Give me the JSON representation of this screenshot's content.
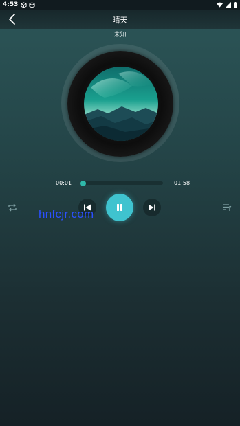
{
  "status_bar": {
    "time": "4:53",
    "left_icons": [
      "cube-icon",
      "cube-outline-icon"
    ],
    "right_icons": [
      "wifi-icon",
      "signal-icon",
      "battery-icon"
    ]
  },
  "header": {
    "title": "晴天",
    "back_icon": "chevron-left-icon"
  },
  "song": {
    "artist": "未知"
  },
  "player": {
    "current_time": "00:01",
    "total_time": "01:58",
    "progress": 0.01,
    "state": "playing"
  },
  "controls": {
    "repeat_icon": "repeat-icon",
    "prev_icon": "skip-previous-icon",
    "play_pause_icon": "pause-icon",
    "next_icon": "skip-next-icon",
    "playlist_icon": "playlist-icon"
  },
  "watermark": "hnfcjr.com",
  "colors": {
    "accent": "#3fc3cf",
    "progress_thumb": "#2fb8a9",
    "watermark": "#2b50ff"
  }
}
